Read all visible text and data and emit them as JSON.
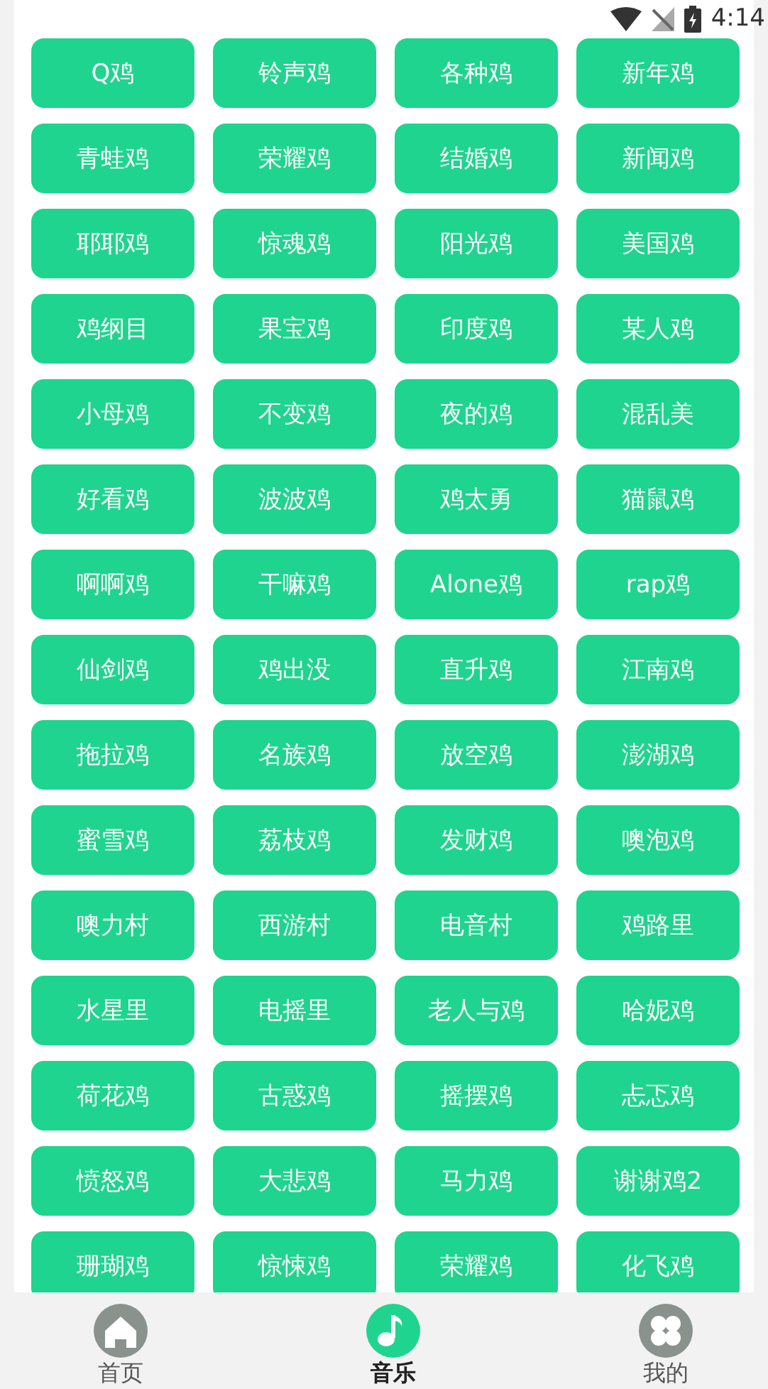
{
  "status_bar": {
    "time": "4:14"
  },
  "items": [
    "Q鸡",
    "铃声鸡",
    "各种鸡",
    "新年鸡",
    "青蛙鸡",
    "荣耀鸡",
    "结婚鸡",
    "新闻鸡",
    "耶耶鸡",
    "惊魂鸡",
    "阳光鸡",
    "美国鸡",
    "鸡纲目",
    "果宝鸡",
    "印度鸡",
    "某人鸡",
    "小母鸡",
    "不变鸡",
    "夜的鸡",
    "混乱美",
    "好看鸡",
    "波波鸡",
    "鸡太勇",
    "猫鼠鸡",
    "啊啊鸡",
    "干嘛鸡",
    "Alone鸡",
    "rap鸡",
    "仙剑鸡",
    "鸡出没",
    "直升鸡",
    "江南鸡",
    "拖拉鸡",
    "名族鸡",
    "放空鸡",
    "澎湖鸡",
    "蜜雪鸡",
    "荔枝鸡",
    "发财鸡",
    "噢泡鸡",
    "噢力村",
    "西游村",
    "电音村",
    "鸡路里",
    "水星里",
    "电摇里",
    "老人与鸡",
    "哈妮鸡",
    "荷花鸡",
    "古惑鸡",
    "摇摆鸡",
    "忐忑鸡",
    "愤怒鸡",
    "大悲鸡",
    "马力鸡",
    "谢谢鸡2",
    "珊瑚鸡",
    "惊悚鸡",
    "荣耀鸡",
    "化飞鸡"
  ],
  "nav": [
    {
      "kind": "home",
      "label": "首页",
      "selected": false
    },
    {
      "kind": "music",
      "label": "音乐",
      "selected": true
    },
    {
      "kind": "mine",
      "label": "我的",
      "selected": false
    }
  ]
}
